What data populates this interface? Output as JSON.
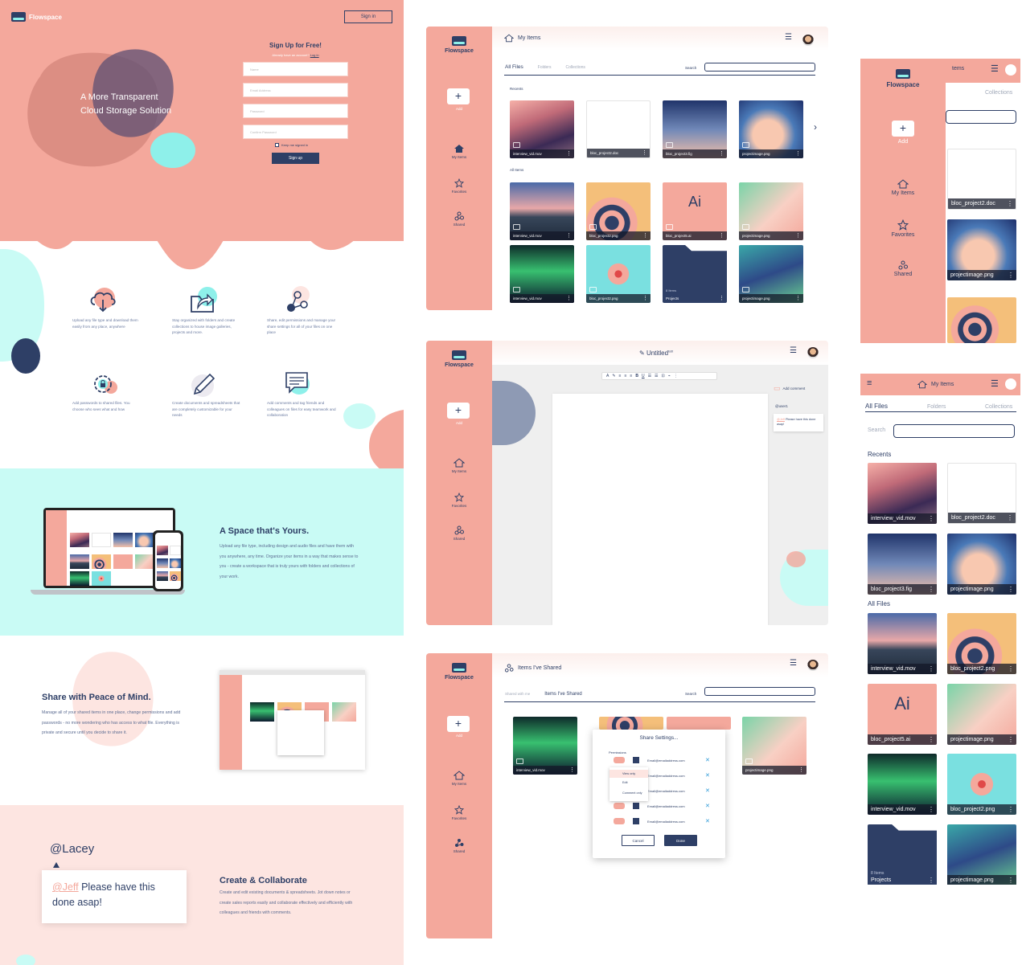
{
  "landing": {
    "brand": "Flowspace",
    "signin_button": "Sign in",
    "hero_title_line1": "A More Transparent",
    "hero_title_line2": "Cloud Storage Solution",
    "signup_title": "Sign Up for Free!",
    "already_text": "Already have an account?",
    "login_link": "Log in",
    "fields": {
      "name": "Name",
      "email": "Email Address",
      "password": "Password",
      "confirm": "Confirm Password"
    },
    "keep_signed_in": "Keep me signed in",
    "signup_button": "Sign up",
    "features": [
      {
        "icon": "cloud-upload-icon",
        "text": "Upload any file type and download them easily from any place, anywhere"
      },
      {
        "icon": "folder-share-icon",
        "text": "Stay organized with folders and create collections to house image galleries, projects and more."
      },
      {
        "icon": "share-node-icon",
        "text": "Share, edit permissions and manage your share settings for all of your files on one place"
      },
      {
        "icon": "gear-lock-icon",
        "text": "Add passwords to shared files. You choose who sees what and how"
      },
      {
        "icon": "pencil-icon",
        "text": "Create documents and spreadsheets that are completely customizable for your needs"
      },
      {
        "icon": "chat-icon",
        "text": "Add comments and tag friends and colleagues on files for easy teamwork and collaboration"
      }
    ],
    "space_title": "A Space that's Yours.",
    "space_text": "Upload any file type, including design and audio files and have them with you anywhere, any time. Organize your items in a way that makes sense to you - create a workspace that is truly yours with folders and collections of your work.",
    "peace_title": "Share with Peace of Mind.",
    "peace_text": "Manage all of your shared items in one place, change permissions and add passwords - no more wondering who has access to what file. Everything is private and secure until you decide to share it.",
    "mention_user": "@Lacey",
    "mention_tag": "@Jeff",
    "mention_text": " Please have this done asap!",
    "collab_title": "Create & Collaborate",
    "collab_text": "Create and edit existing documents & spreadsheets. Jot down notes or create sales reports easily and collaborate effectively and efficiently with colleagues and friends with comments."
  },
  "sidebar": {
    "brand": "Flowspace",
    "add": "Add",
    "my_items": "My Items",
    "favorites": "Favorites",
    "shared": "Shared"
  },
  "my_items": {
    "title": "My Items",
    "tabs": [
      "All Files",
      "Folders",
      "Collections"
    ],
    "search_label": "Search",
    "recents_label": "Recents",
    "all_items_label": "All Items",
    "recents": [
      "interview_vid.mov",
      "bloc_project2.doc",
      "bloc_project3.fig",
      "projectimage.png"
    ],
    "all_items": [
      "interview_vid.mov",
      "bloc_project2.png",
      "bloc_project5.ai",
      "projectimage.png",
      "interview_vid.mov",
      "bloc_project2.png",
      "Projects",
      "projectimage.png"
    ],
    "folder_count": "8 Items",
    "ai_glyph": "Ai"
  },
  "editor": {
    "title": "Untitled",
    "edit_badge": "Edit",
    "add_comment": "Add comment",
    "comment_user": "@user1",
    "comment_tag": "@Jeff",
    "comment_text": " Please have this done asap!",
    "toolbar": [
      "A",
      "✎",
      "≡",
      "≡",
      "≡",
      "B",
      "U",
      "☰",
      "☰",
      "⊡",
      "⌁",
      "⋮"
    ]
  },
  "shared": {
    "title": "Items I've Shared",
    "tabs": [
      "Shared with me",
      "Items I've Shared"
    ],
    "search_label": "Search",
    "items": [
      "interview_vid.mov",
      "projectimage.png"
    ],
    "modal_title": "Share Settings...",
    "permissions_label": "Permissions",
    "options": [
      "View only",
      "Edit",
      "Comment only"
    ],
    "email": "Email@emailaddress.com",
    "cancel": "Cancel",
    "done": "Done"
  },
  "mobile1": {
    "title_fragment": "tems",
    "tab_fragment": "Collections",
    "add": "Add",
    "my_items": "My Items",
    "favorites": "Favorites",
    "shared": "Shared",
    "files": [
      "bloc_project2.doc",
      "projectimage.png"
    ]
  },
  "mobile2": {
    "title": "My Items",
    "tabs": [
      "All Files",
      "Folders",
      "Collections"
    ],
    "search_label": "Search",
    "recents_label": "Recents",
    "all_files_label": "All Files",
    "recents": [
      "interview_vid.mov",
      "bloc_project2.doc",
      "bloc_project3.fig",
      "projectimage.png"
    ],
    "all_files": [
      "interview_vid.mov",
      "bloc_project2.png",
      "bloc_project5.ai",
      "projectimage.png",
      "interview_vid.mov",
      "bloc_project2.png",
      "Projects",
      "projectimage.png"
    ],
    "folder_count": "8 Items",
    "ai_glyph": "Ai"
  },
  "colors": {
    "coral": "#f4a89c",
    "navy": "#2e3f66",
    "mint": "#c9fbf5",
    "aqua": "#8ef0ea",
    "blush": "#fde5e1"
  }
}
